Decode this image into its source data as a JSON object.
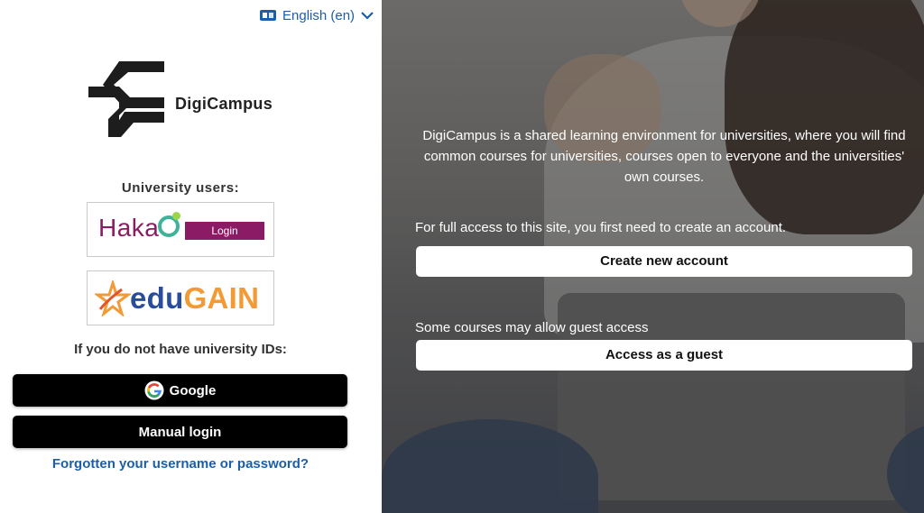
{
  "language": {
    "label": "English (en)",
    "icon": "language-icon",
    "chevron": "chevron-down-icon"
  },
  "brand": {
    "name": "DigiCampus"
  },
  "left": {
    "university_label": "University users:",
    "haka": {
      "word": "Haka",
      "button": "Login"
    },
    "edugain": {
      "word_a": "edu",
      "word_b": "GAIN"
    },
    "no_id_label": "If you do not have university IDs:",
    "google_button": "Google",
    "manual_button": "Manual login",
    "forgot_link": "Forgotten your username or password?"
  },
  "right": {
    "intro": "DigiCampus is a shared learning environment for universities, where you will find common courses for universities, courses open to everyone and the universities' own courses.",
    "need_account": "For full access to this site, you first need to create an account.",
    "create_button": "Create new account",
    "guest_note": "Some courses may allow guest access",
    "guest_button": "Access as a guest"
  },
  "colors": {
    "link": "#1c5fa8",
    "haka": "#8b1b64",
    "edugain_blue": "#2a4d9b",
    "edugain_orange": "#f19a36"
  }
}
